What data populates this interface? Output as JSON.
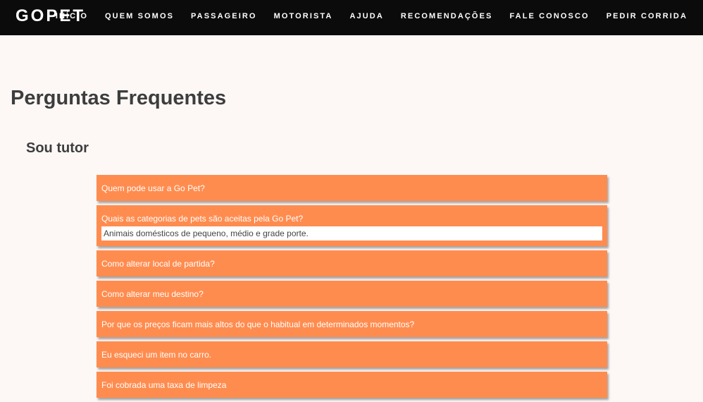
{
  "nav": {
    "brand": "GOPET",
    "links": [
      "INÍCIO",
      "QUEM SOMOS",
      "PASSAGEIRO",
      "MOTORISTA",
      "AJUDA",
      "RECOMENDAÇÕES",
      "FALE CONOSCO",
      "PEDIR CORRIDA"
    ]
  },
  "main": {
    "title": "Perguntas Frequentes",
    "section": "Sou tutor",
    "faqs": [
      {
        "question": "Quem pode usar a Go Pet?"
      },
      {
        "question": "Quais as categorias de pets são aceitas pela Go Pet?",
        "answer": "Animais domésticos de pequeno, médio e grade porte."
      },
      {
        "question": "Como alterar local de partida?"
      },
      {
        "question": "Como alterar meu destino?"
      },
      {
        "question": "Por que os preços ficam mais altos do que o habitual em determinados momentos?"
      },
      {
        "question": "Eu esqueci um item no carro."
      },
      {
        "question": "Foi cobrada uma taxa de limpeza"
      }
    ]
  },
  "colors": {
    "navbar": "#0b0b0b",
    "accent": "#ff8c4f",
    "background": "#fdf8f6",
    "heading": "#3d3d3d"
  }
}
